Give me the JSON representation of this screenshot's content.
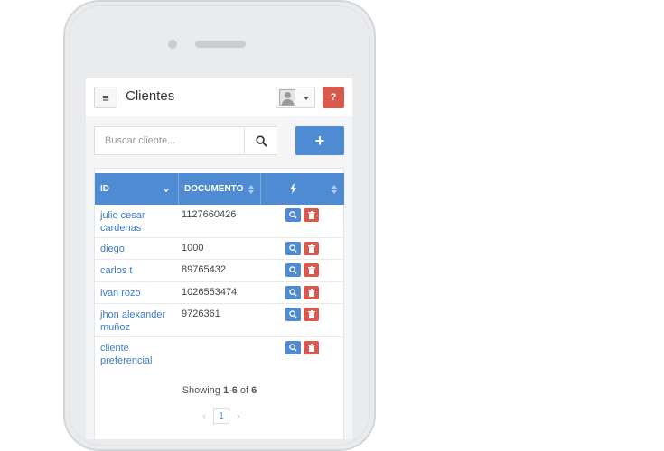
{
  "header": {
    "title": "Clientes",
    "menu_icon": "≡",
    "help_label": "?"
  },
  "search": {
    "placeholder": "Buscar cliente...",
    "value": ""
  },
  "add_button": {
    "label": "+"
  },
  "table": {
    "columns": [
      "ID",
      "DOCUMENTO",
      ""
    ],
    "rows": [
      {
        "name": "julio cesar cardenas",
        "documento": "1127660426"
      },
      {
        "name": "diego",
        "documento": "1000"
      },
      {
        "name": "carlos t",
        "documento": "89765432"
      },
      {
        "name": "ivan rozo",
        "documento": "1026553474"
      },
      {
        "name": "jhon alexander muñoz",
        "documento": "9726361"
      },
      {
        "name": "cliente preferencial",
        "documento": ""
      }
    ]
  },
  "pagination": {
    "summary_prefix": "Showing ",
    "summary_range": "1-6",
    "summary_mid": " of ",
    "summary_total": "6",
    "prev": "‹",
    "page": "1",
    "next": "›"
  },
  "colors": {
    "accent": "#4f8bd3",
    "danger": "#d9594c",
    "link": "#3d7cc9"
  }
}
